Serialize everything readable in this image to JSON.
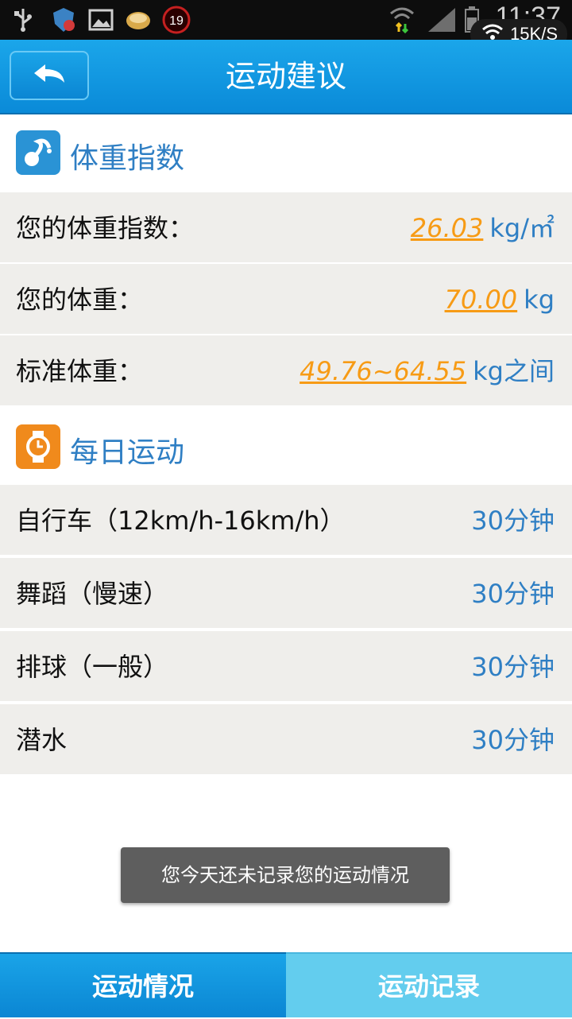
{
  "status_bar": {
    "time": "11:37",
    "net_speed": "15K/S",
    "badge_count": "19"
  },
  "header": {
    "title": "运动建议"
  },
  "bmi_section": {
    "title": "体重指数",
    "rows": [
      {
        "label": "您的体重指数：",
        "value": "26.03",
        "unit": "kg/㎡"
      },
      {
        "label": "您的体重：",
        "value": "70.00",
        "unit": "kg"
      },
      {
        "label": "标准体重：",
        "value": "49.76~64.55",
        "unit": "kg之间"
      }
    ]
  },
  "exercise_section": {
    "title": "每日运动",
    "rows": [
      {
        "label": "自行车（12km/h-16km/h）",
        "duration": "30分钟"
      },
      {
        "label": "舞蹈（慢速）",
        "duration": "30分钟"
      },
      {
        "label": "排球（一般）",
        "duration": "30分钟"
      },
      {
        "label": "潜水",
        "duration": "30分钟"
      }
    ]
  },
  "toast": {
    "message": "您今天还未记录您的运动情况"
  },
  "tabs": {
    "left": "运动情况",
    "right": "运动记录"
  },
  "colors": {
    "header_blue": "#0a8ad8",
    "value_orange": "#f79b15",
    "accent_blue": "#2f7fc4",
    "row_bg": "#efeeeb",
    "tab_active": "#63cdee"
  }
}
